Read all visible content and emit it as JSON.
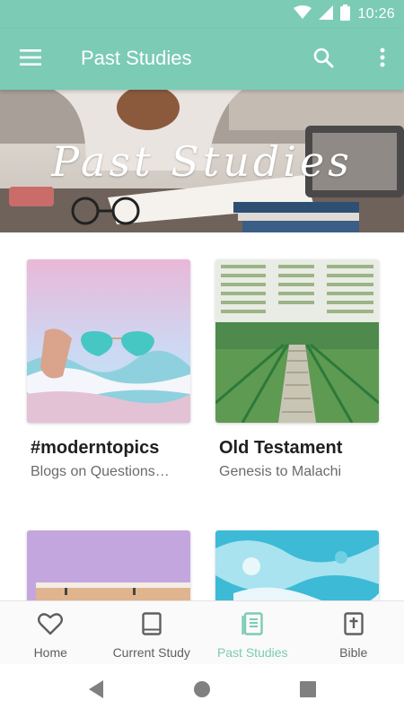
{
  "status_bar": {
    "time": "10:26",
    "icons": [
      "wifi-icon",
      "signal-icon",
      "battery-icon"
    ]
  },
  "app_bar": {
    "title": "Past Studies",
    "icons": [
      "menu-icon",
      "search-icon",
      "overflow-menu-icon"
    ]
  },
  "banner": {
    "text": "Past Studies"
  },
  "studies": [
    {
      "title": "#moderntopics",
      "subtitle": "Blogs on Questions…"
    },
    {
      "title": "Old Testament",
      "subtitle": "Genesis to Malachi"
    },
    {
      "title": "",
      "subtitle": ""
    },
    {
      "title": "",
      "subtitle": ""
    }
  ],
  "bottom_nav": {
    "items": [
      {
        "label": "Home",
        "icon": "heart-icon"
      },
      {
        "label": "Current Study",
        "icon": "book-icon"
      },
      {
        "label": "Past Studies",
        "icon": "book-stack-icon",
        "active": true
      },
      {
        "label": "Bible",
        "icon": "bible-cross-icon"
      }
    ]
  },
  "system_nav": [
    "back-icon",
    "home-circle-icon",
    "recents-icon"
  ],
  "colors": {
    "accent": "#7ccbb5",
    "text_primary": "#1f1f1f",
    "text_secondary": "#6b6b6b",
    "nav_inactive": "#5f5f5f"
  }
}
